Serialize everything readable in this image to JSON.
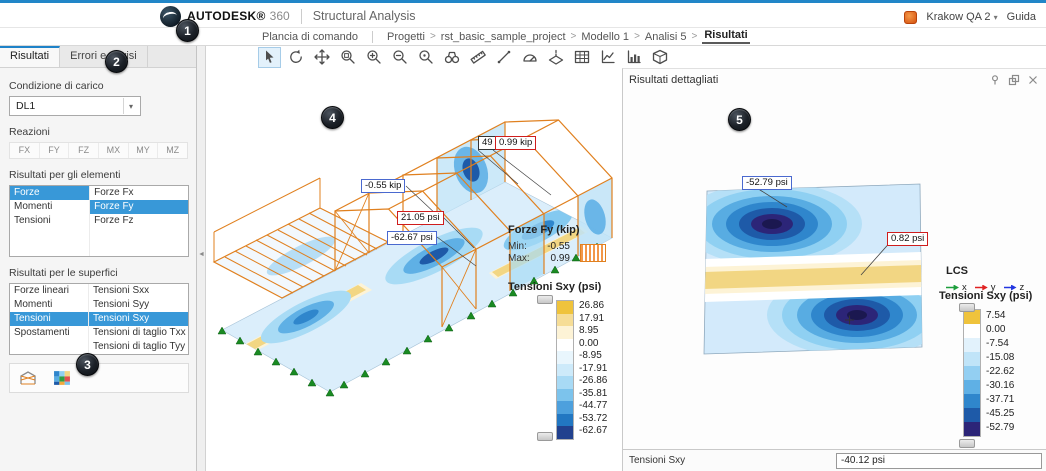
{
  "header": {
    "brand_name": "AUTODESK®",
    "brand_suffix": "360",
    "app_title": "Structural Analysis",
    "user_menu": "Krakow QA 2",
    "help": "Guida"
  },
  "breadcrumb": {
    "root": "Plancia di comando",
    "separator": ">",
    "items": [
      "Progetti",
      "rst_basic_sample_project",
      "Modello 1",
      "Analisi 5",
      "Risultati"
    ]
  },
  "toolbar": {
    "tools": [
      "select",
      "orbit",
      "pan",
      "zoom-window",
      "zoom-in",
      "zoom-out",
      "zoom-fit",
      "find",
      "measure-ruler",
      "measure-distance",
      "protractor",
      "section-plane",
      "table-view",
      "diagram-view",
      "chart-view",
      "section-box"
    ]
  },
  "left_panel": {
    "tabs": [
      {
        "label": "Risultati"
      },
      {
        "label": "Errori e avvisi"
      }
    ],
    "load_case": {
      "label": "Condizione di carico",
      "value": "DL1"
    },
    "reactions": {
      "label": "Reazioni",
      "components": [
        "FX",
        "FY",
        "FZ",
        "MX",
        "MY",
        "MZ"
      ]
    },
    "element_results": {
      "label": "Risultati per gli elementi",
      "categories": [
        "Forze",
        "Momenti",
        "Tensioni"
      ],
      "selected_category": "Forze",
      "options": [
        "Forze Fx",
        "Forze Fy",
        "Forze Fz"
      ],
      "selected_option": "Forze Fy"
    },
    "surface_results": {
      "label": "Risultati per le superfici",
      "categories": [
        "Forze lineari",
        "Momenti",
        "Tensioni",
        "Spostamenti"
      ],
      "selected_category": "Tensioni",
      "options": [
        "Tensioni Sxx",
        "Tensioni Syy",
        "Tensioni Sxy",
        "Tensioni di taglio Txx",
        "Tensioni di taglio Tyy"
      ],
      "selected_option": "Tensioni Sxy"
    }
  },
  "canvas": {
    "annotations": {
      "node_id": "49",
      "fy_max": "0.99 kip",
      "fy_min": "-0.55 kip",
      "sxy_max": "21.05 psi",
      "sxy_min": "-62.67 psi"
    },
    "force_legend": {
      "title": "Forze Fy (kip)",
      "min_label": "Min:",
      "min_value": "-0.55",
      "max_label": "Max:",
      "max_value": "0.99"
    },
    "stress_legend": {
      "title": "Tensioni Sxy (psi)",
      "entries": [
        {
          "value": "26.86",
          "color": "#efc33c"
        },
        {
          "value": "17.91",
          "color": "#f6dd96"
        },
        {
          "value": "8.95",
          "color": "#fdf3d6"
        },
        {
          "value": "0.00",
          "color": "#ffffff"
        },
        {
          "value": "-8.95",
          "color": "#e9f6fd"
        },
        {
          "value": "-17.91",
          "color": "#cdeafa"
        },
        {
          "value": "-26.86",
          "color": "#a8daf5"
        },
        {
          "value": "-35.81",
          "color": "#7cc3ec"
        },
        {
          "value": "-44.77",
          "color": "#4da0dd"
        },
        {
          "value": "-53.72",
          "color": "#2277c2"
        },
        {
          "value": "-62.67",
          "color": "#22418e"
        }
      ]
    }
  },
  "right_panel": {
    "title": "Risultati dettagliati",
    "annotations": {
      "min": "-52.79 psi",
      "probe": "0.82 psi"
    },
    "lcs": {
      "title": "LCS",
      "axes": [
        {
          "label": "x",
          "color": "#1d9e3c"
        },
        {
          "label": "y",
          "color": "#e02222"
        },
        {
          "label": "z",
          "color": "#2236e0"
        }
      ]
    },
    "stress_legend": {
      "title": "Tensioni Sxy (psi)",
      "entries": [
        {
          "value": "7.54",
          "color": "#efc33c"
        },
        {
          "value": "0.00",
          "color": "#ffffff"
        },
        {
          "value": "-7.54",
          "color": "#e2f2fc"
        },
        {
          "value": "-15.08",
          "color": "#c0e4f8"
        },
        {
          "value": "-22.62",
          "color": "#93cff2"
        },
        {
          "value": "-30.16",
          "color": "#5fb0e5"
        },
        {
          "value": "-37.71",
          "color": "#2f86cc"
        },
        {
          "value": "-45.25",
          "color": "#1e5aa8"
        },
        {
          "value": "-52.79",
          "color": "#2c2578"
        }
      ]
    },
    "probe": {
      "label": "Tensioni Sxy",
      "value": "-40.12 psi"
    }
  },
  "callouts": [
    "1",
    "2",
    "3",
    "4",
    "5"
  ]
}
